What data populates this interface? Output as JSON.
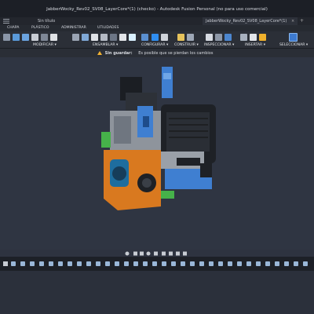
{
  "window": {
    "title": "JabberWocky_Rev02_SV08_LayerCore*(1) (checko) - Autodesk Fusion Personal (no para uso comercial)"
  },
  "tabs": [
    {
      "label": "Sin título",
      "active": false
    },
    {
      "label": "JabberWocky_Rev02_SV08_LayerCore*(1)",
      "active": true
    }
  ],
  "workspace_tabs": [
    "CHAPA",
    "PLÁSTICO",
    "ADMINISTRAR",
    "UTILIDADES"
  ],
  "ribbon_groups": [
    "MODIFICAR ▾",
    "ENSAMBLAR ▾",
    "CONFIGURAR ▾",
    "CONSTRUIR ▾",
    "INSPECCIONAR ▾",
    "INSERTAR ▾",
    "SELECCIONAR ▾"
  ],
  "warning": {
    "label": "Sin guardar:",
    "message": "Es posible que se pierdan los cambios"
  },
  "colors": {
    "accent": "#f2b233",
    "orange_part": "#d9791f",
    "blue_part": "#3f7fd1",
    "green_part": "#46b24a",
    "dark_part": "#1e2126"
  }
}
